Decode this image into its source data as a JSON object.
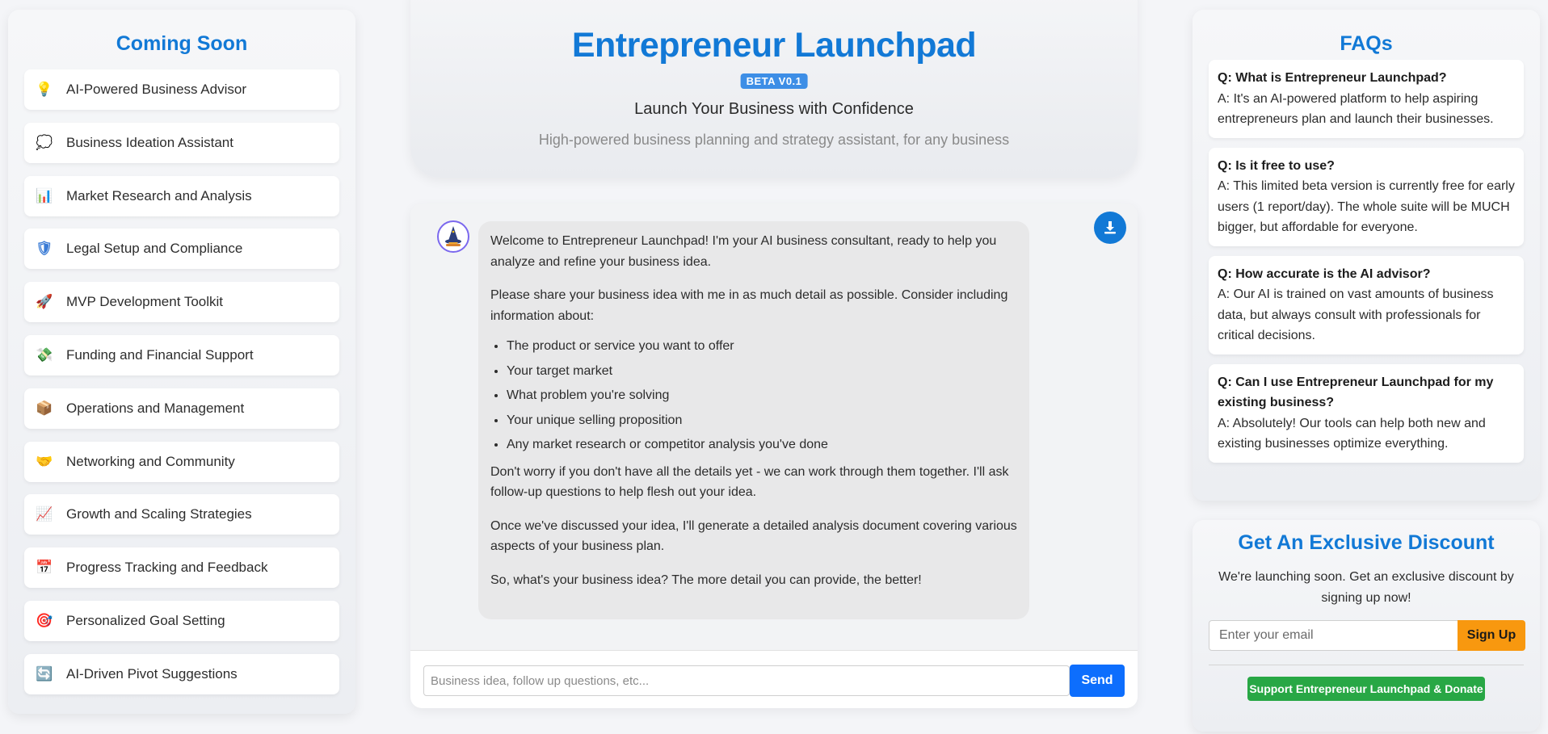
{
  "sidebar": {
    "title": "Coming Soon",
    "items": [
      {
        "label": "AI-Powered Business Advisor",
        "icon": "lightbulb-icon",
        "glyph": "💡",
        "color": "#f5c518"
      },
      {
        "label": "Business Ideation Assistant",
        "icon": "thought-bubble-icon",
        "glyph": "💭",
        "color": "#d8d2f0"
      },
      {
        "label": "Market Research and Analysis",
        "icon": "bar-chart-icon",
        "glyph": "📊",
        "color": "#e9e4d8"
      },
      {
        "label": "Legal Setup and Compliance",
        "icon": "shield-icon",
        "glyph": "🛡",
        "color": "#3a7bd5"
      },
      {
        "label": "MVP Development Toolkit",
        "icon": "rocket-icon",
        "glyph": "🚀",
        "color": "#e8505b"
      },
      {
        "label": "Funding and Financial Support",
        "icon": "money-icon",
        "glyph": "💸",
        "color": "#4caf50"
      },
      {
        "label": "Operations and Management",
        "icon": "package-icon",
        "glyph": "📦",
        "color": "#b8834f"
      },
      {
        "label": "Networking and Community",
        "icon": "handshake-icon",
        "glyph": "🤝",
        "color": "#f5b342"
      },
      {
        "label": "Growth and Scaling Strategies",
        "icon": "trending-up-icon",
        "glyph": "📈",
        "color": "#dfe4f2"
      },
      {
        "label": "Progress Tracking and Feedback",
        "icon": "calendar-icon",
        "glyph": "📅",
        "color": "#6b8fe8"
      },
      {
        "label": "Personalized Goal Setting",
        "icon": "target-icon",
        "glyph": "🎯",
        "color": "#e0344a"
      },
      {
        "label": "AI-Driven Pivot Suggestions",
        "icon": "refresh-icon",
        "glyph": "🔄",
        "color": "#3b8fe8"
      }
    ]
  },
  "hero": {
    "title": "Entrepreneur Launchpad",
    "badge": "BETA V0.1",
    "subtitle": "Launch Your Business with Confidence",
    "tagline": "High-powered business planning and strategy assistant, for any business"
  },
  "chat": {
    "message": {
      "p1": "Welcome to Entrepreneur Launchpad! I'm your AI business consultant, ready to help you analyze and refine your business idea.",
      "p2": "Please share your business idea with me in as much detail as possible. Consider including information about:",
      "bullets": [
        "The product or service you want to offer",
        "Your target market",
        "What problem you're solving",
        "Your unique selling proposition",
        "Any market research or competitor analysis you've done"
      ],
      "p3": "Don't worry if you don't have all the details yet - we can work through them together. I'll ask follow-up questions to help flesh out your idea.",
      "p4": "Once we've discussed your idea, I'll generate a detailed analysis document covering various aspects of your business plan.",
      "p5": "So, what's your business idea? The more detail you can provide, the better!"
    },
    "input_placeholder": "Business idea, follow up questions, etc...",
    "send_label": "Send",
    "download_icon": "download-icon"
  },
  "faq": {
    "title": "FAQs",
    "items": [
      {
        "q": "Q: What is Entrepreneur Launchpad?",
        "a": "A: It's an AI-powered platform to help aspiring entrepreneurs plan and launch their businesses."
      },
      {
        "q": "Q: Is it free to use?",
        "a": "A: This limited beta version is currently free for early users (1 report/day). The whole suite will be MUCH bigger, but affordable for everyone."
      },
      {
        "q": "Q: How accurate is the AI advisor?",
        "a": "A: Our AI is trained on vast amounts of business data, but always consult with professionals for critical decisions."
      },
      {
        "q": "Q: Can I use Entrepreneur Launchpad for my existing business?",
        "a": "A: Absolutely! Our tools can help both new and existing businesses optimize everything."
      }
    ]
  },
  "discount": {
    "title": "Get An Exclusive Discount",
    "text": "We're launching soon. Get an exclusive discount by signing up now!",
    "email_placeholder": "Enter your email",
    "signup_label": "Sign Up",
    "donate_label": "Support Entrepreneur Launchpad & Donate"
  },
  "colors": {
    "accent": "#1279d6",
    "send": "#0d6efd",
    "signup": "#f8980f",
    "donate": "#28a745"
  }
}
